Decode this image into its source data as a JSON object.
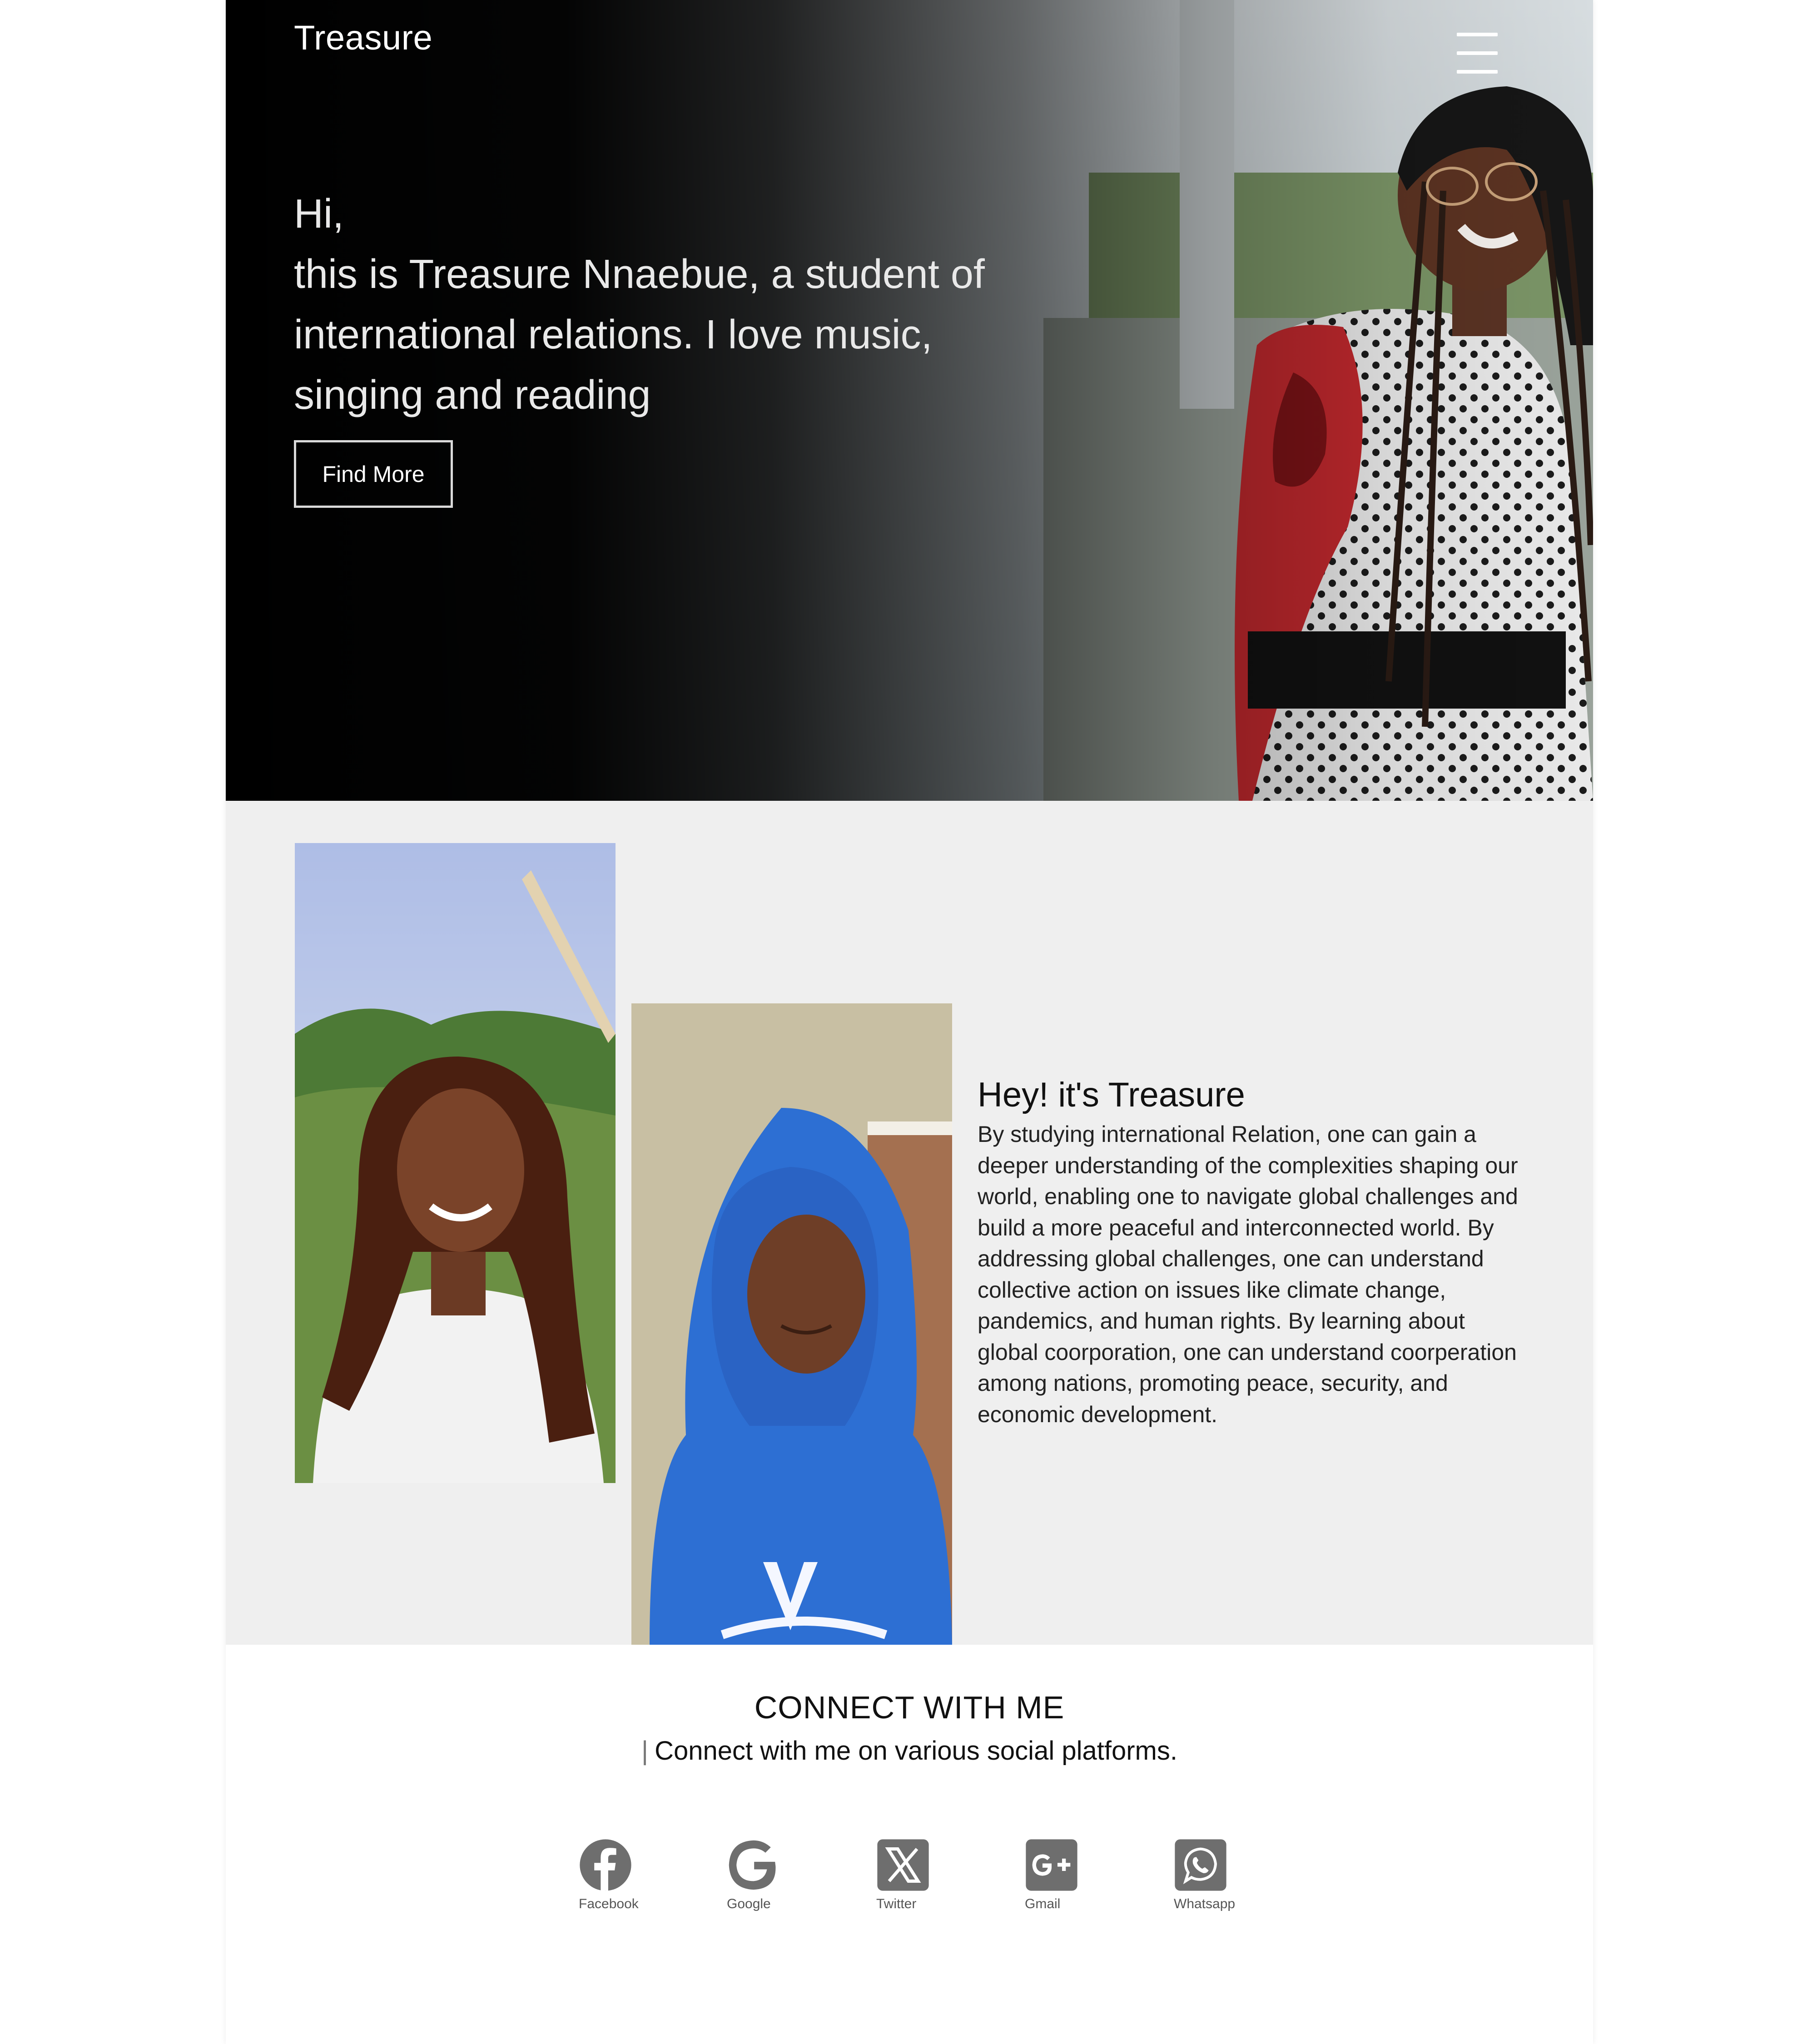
{
  "header": {
    "brand": "Treasure",
    "menu_icon": "hamburger-menu-icon"
  },
  "hero": {
    "greeting": "Hi,",
    "intro": "this is Treasure Nnaebue, a student of international relations. I love music, singing and reading",
    "cta_label": "Find More"
  },
  "about": {
    "title": "Hey! it's Treasure",
    "body": "By studying international Relation, one can gain a deeper understanding of the complexities shaping our world, enabling one to navigate global challenges and build a more peaceful and interconnected world. By addressing global challenges, one can understand collective action on issues like climate change, pandemics, and human rights. By learning about global coorporation, one can understand coorperation among nations, promoting peace, security, and economic development."
  },
  "connect": {
    "title": "CONNECT WITH ME",
    "bar": "|",
    "subtitle": "Connect with me on various social platforms.",
    "socials": [
      {
        "label": "Facebook",
        "icon": "facebook-icon"
      },
      {
        "label": "Google",
        "icon": "google-icon"
      },
      {
        "label": "Twitter",
        "icon": "x-twitter-icon"
      },
      {
        "label": "Gmail",
        "icon": "google-plus-icon"
      },
      {
        "label": "Whatsapp",
        "icon": "whatsapp-icon"
      }
    ]
  },
  "colors": {
    "hero_overlay": "#000000",
    "about_bg": "#efefef",
    "icon_gray": "#6e6e6e",
    "dress_red": "#c0282d"
  }
}
